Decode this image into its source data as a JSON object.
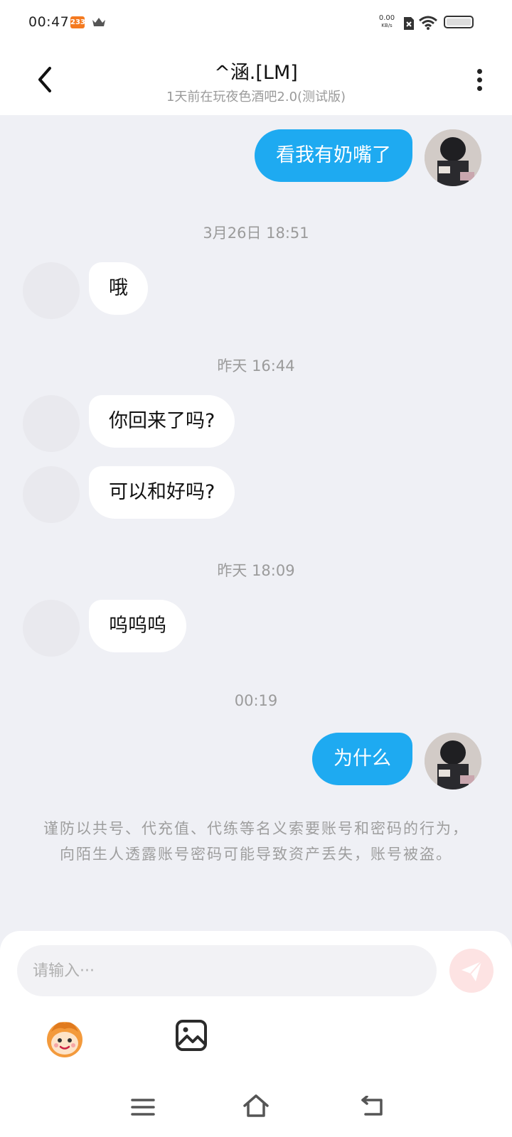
{
  "status_bar": {
    "time": "00:47",
    "app_badge": "233",
    "net_speed": "0.00",
    "net_unit": "KB/s",
    "icons": [
      "crown-icon",
      "sim-icon",
      "wifi-icon",
      "battery-icon"
    ]
  },
  "header": {
    "title": "^涵.[LM]",
    "subtitle": "1天前在玩夜色酒吧2.0(测试版)",
    "back_icon": "chevron-left-icon",
    "more_icon": "more-vertical-icon"
  },
  "messages": [
    {
      "type": "out",
      "text": "看我有奶嘴了"
    },
    {
      "type": "timestamp",
      "text": "3月26日 18:51"
    },
    {
      "type": "in",
      "text": "哦"
    },
    {
      "type": "timestamp",
      "text": "昨天 16:44"
    },
    {
      "type": "in",
      "text": "你回来了吗?"
    },
    {
      "type": "in",
      "text": "可以和好吗?"
    },
    {
      "type": "timestamp",
      "text": "昨天 18:09"
    },
    {
      "type": "in",
      "text": "呜呜呜"
    },
    {
      "type": "timestamp",
      "text": "00:19"
    },
    {
      "type": "out",
      "text": "为什么"
    }
  ],
  "notice": "谨防以共号、代充值、代练等名义索要账号和密码的行为，向陌生人透露账号密码可能导致资产丢失，账号被盗。",
  "input": {
    "placeholder": "请输入···"
  },
  "toolbar_icons": [
    "emoji-icon",
    "image-icon",
    "send-icon"
  ],
  "colors": {
    "accent": "#1eaaf1",
    "background": "#eff0f5",
    "send_disabled": "#fde3e3"
  }
}
